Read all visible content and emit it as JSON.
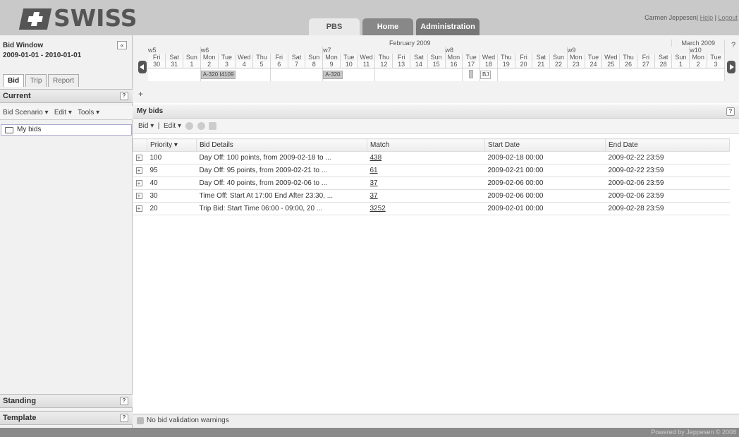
{
  "brand": {
    "word": "SWISS"
  },
  "topnav": {
    "tabs": [
      {
        "label": "PBS"
      },
      {
        "label": "Home"
      },
      {
        "label": "Administration"
      }
    ]
  },
  "user": {
    "name": "Carmen Jeppesen",
    "sep1": "|",
    "help": "Help",
    "sep2": "|",
    "logout": "Logout"
  },
  "left": {
    "title": "Bid Window",
    "range": "2009-01-01 - 2010-01-01",
    "collapse": "«",
    "tabs": [
      {
        "label": "Bid"
      },
      {
        "label": "Trip"
      },
      {
        "label": "Report"
      }
    ],
    "current": "Current",
    "help_q": "?",
    "scenario": "Bid Scenario",
    "edit": "Edit",
    "tools": "Tools",
    "tree_item": "My bids",
    "standing": "Standing",
    "template": "Template"
  },
  "calendar": {
    "month": "February 2009",
    "next_month": "March 2009",
    "help": "?",
    "add": "+",
    "weeks": [
      "w5",
      "w6",
      "w7",
      "w8",
      "w9",
      "w10"
    ],
    "days": [
      "Fri",
      "Sat",
      "Sun",
      "Mon",
      "Tue",
      "Wed",
      "Thu",
      "Fri",
      "Sat",
      "Sun",
      "Mon",
      "Tue",
      "Wed",
      "Thu",
      "Fri",
      "Sat",
      "Sun",
      "Mon",
      "Tue",
      "Wed",
      "Thu",
      "Fri",
      "Sat",
      "Sun",
      "Mon",
      "Tue",
      "Wed",
      "Thu",
      "Fri",
      "Sat",
      "Sun",
      "Mon",
      "Tue"
    ],
    "dates": [
      "30",
      "31",
      "1",
      "2",
      "3",
      "4",
      "5",
      "6",
      "7",
      "8",
      "9",
      "10",
      "11",
      "12",
      "13",
      "14",
      "15",
      "16",
      "17",
      "18",
      "19",
      "20",
      "21",
      "22",
      "23",
      "24",
      "25",
      "26",
      "27",
      "28",
      "1",
      "2",
      "3"
    ],
    "trips": [
      "A-320 I4109",
      "A-320",
      "BJ"
    ]
  },
  "main": {
    "title": "My bids",
    "help": "?",
    "toolbar": {
      "bid": "Bid",
      "edit": "Edit"
    },
    "columns": [
      "Priority",
      "Bid Details",
      "Match",
      "Start Date",
      "End Date"
    ],
    "rows": [
      {
        "priority": "100",
        "details": "Day Off: 100 points, from 2009-02-18 to ...",
        "match": "438",
        "start": "2009-02-18 00:00",
        "end": "2009-02-22 23:59"
      },
      {
        "priority": "95",
        "details": "Day Off: 95 points, from 2009-02-21 to ...",
        "match": "61",
        "start": "2009-02-21 00:00",
        "end": "2009-02-22 23:59"
      },
      {
        "priority": "40",
        "details": "Day Off: 40 points, from 2009-02-06 to ...",
        "match": "37",
        "start": "2009-02-06 00:00",
        "end": "2009-02-06 23:59"
      },
      {
        "priority": "30",
        "details": "Time Off: Start At 17:00 End After 23:30, ...",
        "match": "37",
        "start": "2009-02-06 00:00",
        "end": "2009-02-06 23:59"
      },
      {
        "priority": "20",
        "details": "Trip Bid: Start Time 06:00 - 09:00, 20 ...",
        "match": "3252",
        "start": "2009-02-01 00:00",
        "end": "2009-02-28 23:59"
      }
    ]
  },
  "status": {
    "text": "No bid validation warnings"
  },
  "footer": {
    "text": "Powered by Jeppesen © 2008"
  }
}
